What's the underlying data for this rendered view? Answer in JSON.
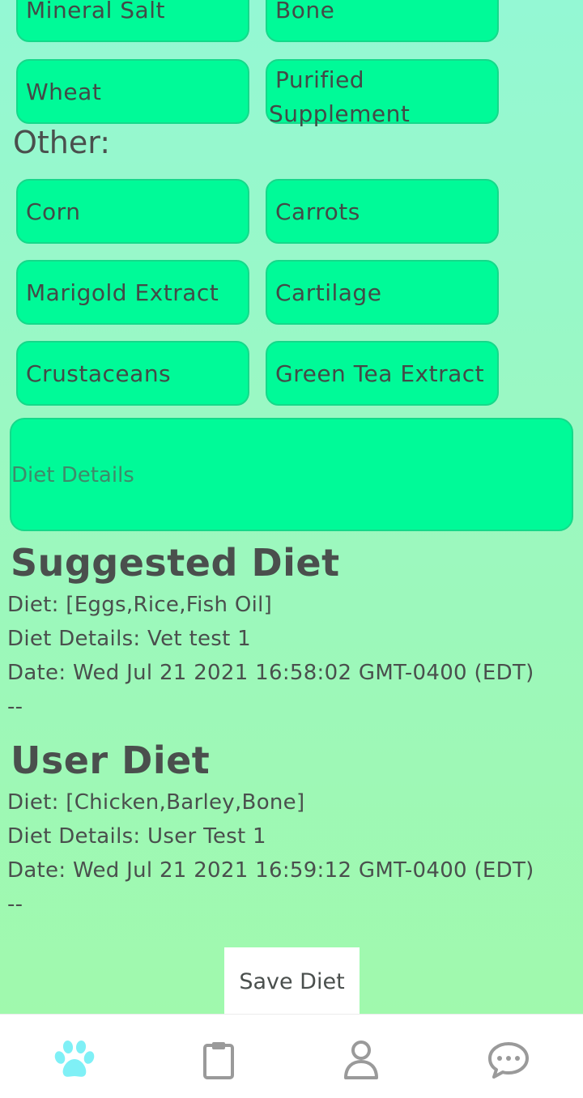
{
  "ingredients_top": {
    "row1": [
      "Mineral Salt",
      "Bone"
    ],
    "row2_left": "Wheat",
    "row2_right_line1": "Purified",
    "row2_right_line2": "Supplement"
  },
  "other": {
    "label": "Other:",
    "items": [
      "Corn",
      "Carrots",
      "Marigold Extract",
      "Cartilage",
      "Crustaceans",
      "Green Tea Extract"
    ]
  },
  "details_input": {
    "placeholder": "Diet Details",
    "value": ""
  },
  "suggested": {
    "title": "Suggested Diet",
    "diet": "Diet: [Eggs,Rice,Fish Oil]",
    "details": "Diet Details: Vet test 1",
    "date": "Date: Wed Jul 21 2021 16:58:02 GMT-0400 (EDT)",
    "separator": "--"
  },
  "user": {
    "title": "User Diet",
    "diet": "Diet: [Chicken,Barley,Bone]",
    "details": "Diet Details: User Test 1",
    "date": "Date: Wed Jul 21 2021 16:59:12 GMT-0400 (EDT)",
    "separator": "--"
  },
  "save_label": "Save Diet",
  "tabs": [
    {
      "icon": "paw-icon",
      "active": true
    },
    {
      "icon": "clipboard-icon",
      "active": false
    },
    {
      "icon": "profile-icon",
      "active": false
    },
    {
      "icon": "chat-icon",
      "active": false
    }
  ],
  "colors": {
    "chip_bg": "#00fa98",
    "chip_border": "#15d98a",
    "active_tab": "#7ff0f6",
    "inactive_tab": "#9a9a9a",
    "text": "#4a4f4d"
  }
}
